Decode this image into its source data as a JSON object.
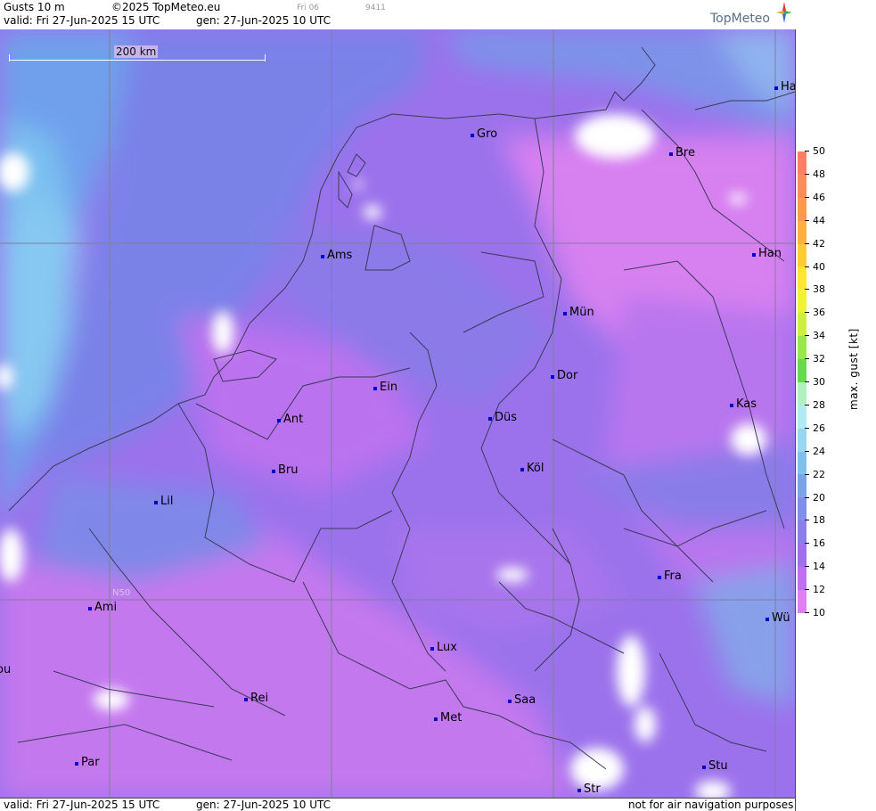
{
  "header": {
    "product": "Gusts 10 m",
    "copyright": "©2025 TopMeteo.eu",
    "day_code": "Fri 06",
    "code": "9411",
    "valid": "valid:  Fri  27-Jun-2025  15 UTC",
    "gen": "gen: 27-Jun-2025 10 UTC",
    "logo_text": "TopMeteo"
  },
  "footer": {
    "valid": "valid:  Fri  27-Jun-2025  15 UTC",
    "gen": "gen: 27-Jun-2025 10 UTC",
    "disclaimer": "not for air navigation purposes"
  },
  "scale_bar": {
    "label": "200 km"
  },
  "grid_label": "N50",
  "cities": [
    {
      "name": "Ha"
    },
    {
      "name": "Gro"
    },
    {
      "name": "Bre"
    },
    {
      "name": "Ams"
    },
    {
      "name": "Han"
    },
    {
      "name": "Mün"
    },
    {
      "name": "Dor"
    },
    {
      "name": "Ein"
    },
    {
      "name": "Kas"
    },
    {
      "name": "Ant"
    },
    {
      "name": "Düs"
    },
    {
      "name": "Bru"
    },
    {
      "name": "Köl"
    },
    {
      "name": "Lil"
    },
    {
      "name": "Fra"
    },
    {
      "name": "Ami"
    },
    {
      "name": "Wü"
    },
    {
      "name": "Lux"
    },
    {
      "name": "ou"
    },
    {
      "name": "Rei"
    },
    {
      "name": "Saa"
    },
    {
      "name": "Met"
    },
    {
      "name": "Par"
    },
    {
      "name": "Stu"
    },
    {
      "name": "Str"
    }
  ],
  "legend": {
    "unit_label": "max. gust [kt]",
    "ticks": [
      "50",
      "48",
      "46",
      "44",
      "42",
      "40",
      "38",
      "36",
      "34",
      "32",
      "30",
      "28",
      "26",
      "24",
      "22",
      "20",
      "18",
      "16",
      "14",
      "12",
      "10"
    ],
    "colors": {
      "50": "#ff7f66",
      "48": "#ff8c5a",
      "46": "#ff9a4d",
      "44": "#ffb040",
      "42": "#ffcc33",
      "40": "#ffe633",
      "38": "#f2f233",
      "36": "#ccef40",
      "34": "#99e64d",
      "32": "#66d94d",
      "30": "#b3f0c0",
      "28": "#b3e8f5",
      "26": "#99d6f2",
      "24": "#80c0ec",
      "22": "#7aa4e6",
      "20": "#7f8ee8",
      "18": "#8c7ee8",
      "16": "#a070ec",
      "14": "#c070ee",
      "12": "#e080f0"
    }
  },
  "colors": {
    "background_field": "#9b72ec",
    "grid": "#7f7f9a",
    "borders": "#333333"
  }
}
